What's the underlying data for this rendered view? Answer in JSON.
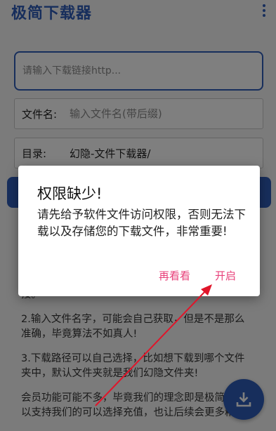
{
  "app": {
    "title": "极简下载器",
    "menu_icon": "more-vertical-icon",
    "accent_color": "#2f5cb8"
  },
  "form": {
    "url_placeholder": "请输入下载链接http...",
    "filename_label": "文件名:",
    "filename_placeholder": "输入文件名(带后缀)",
    "directory_label": "目录:",
    "directory_value": "幻隐-文件下载器/"
  },
  "notes": {
    "line1": "接。",
    "line2": "2.输入文件名字，可能会自己获取，但是不是那么准确，毕竟算法不如真人!",
    "line3": "3.下载路径可以自己选择，比如想下载到哪个文件夹中，默认文件夹就是我们幻隐文件夹!",
    "line4": "会员功能可能不多，毕竟我们的理念即是极简，所以支持我们的可以选择充值，也让后续会更多精彩!"
  },
  "fab": {
    "icon": "download-icon"
  },
  "dialog": {
    "title": "权限缺少!",
    "message": "请先给予软件文件访问权限，否则无法下载以及存储您的下载文件，非常重要!",
    "cancel_label": "再看看",
    "confirm_label": "开启",
    "button_color": "#e8407a"
  },
  "annotation": {
    "arrow_color": "#e0152a"
  }
}
